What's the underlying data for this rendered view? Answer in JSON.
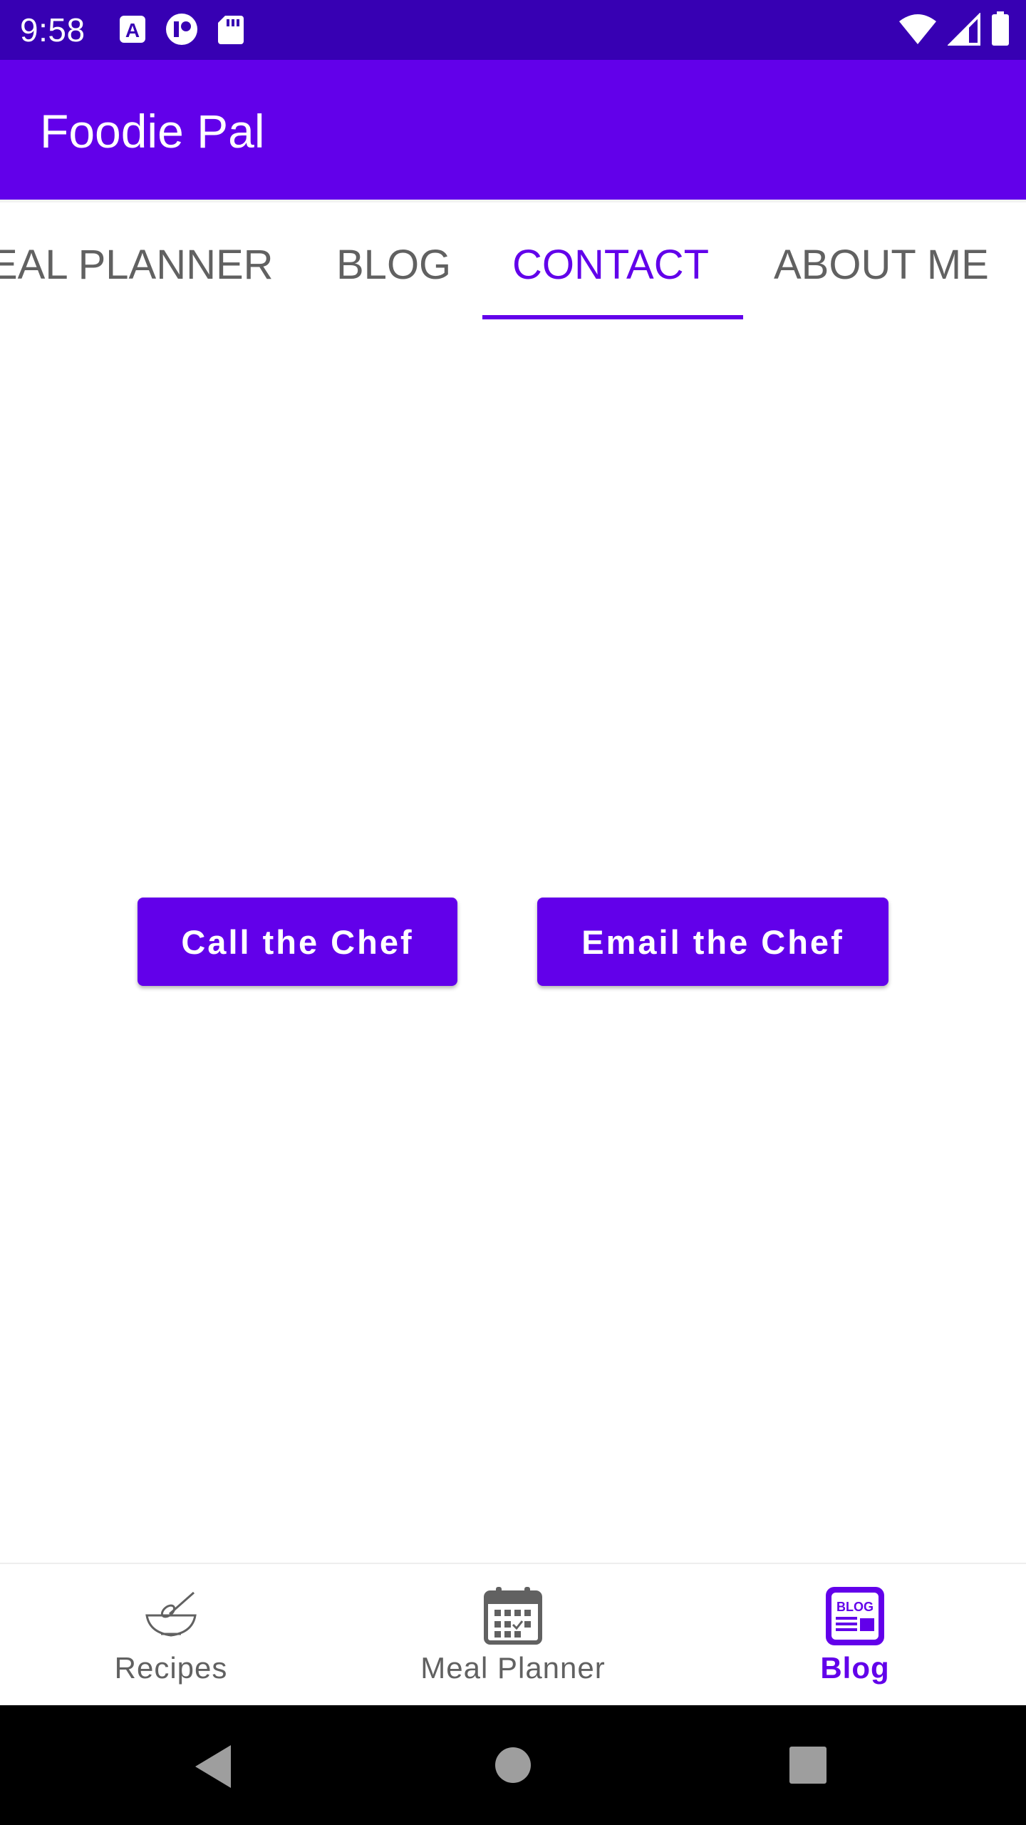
{
  "status_bar": {
    "time": "9:58",
    "left_icons": [
      "a-box-icon",
      "vpn-icon",
      "sd-card-icon"
    ],
    "right_icons": [
      "wifi-icon",
      "signal-icon",
      "battery-icon"
    ]
  },
  "app_bar": {
    "title": "Foodie Pal"
  },
  "tabs": [
    {
      "label": "EAL PLANNER",
      "active": false
    },
    {
      "label": "BLOG",
      "active": false
    },
    {
      "label": "CONTACT",
      "active": true
    },
    {
      "label": "ABOUT ME",
      "active": false
    }
  ],
  "contact": {
    "call_button": "Call the Chef",
    "email_button": "Email the Chef"
  },
  "bottom_nav": [
    {
      "label": "Recipes",
      "icon": "whisk-bowl-icon",
      "active": false
    },
    {
      "label": "Meal Planner",
      "icon": "calendar-icon",
      "active": false
    },
    {
      "label": "Blog",
      "icon": "blog-icon",
      "active": true
    }
  ],
  "colors": {
    "primary": "#6200ea",
    "primary_dark": "#3700b3",
    "inactive": "#616161"
  }
}
